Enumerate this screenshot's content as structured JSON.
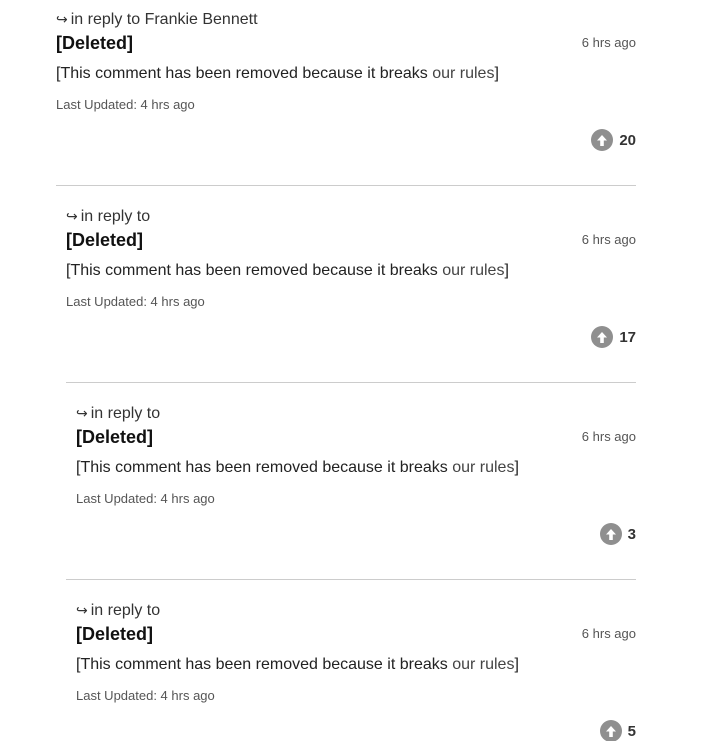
{
  "comments": [
    {
      "reply_prefix": "in reply to",
      "reply_target": "Frankie Bennett",
      "author": "[Deleted]",
      "time": "6 hrs ago",
      "body_text": "[This comment has been removed because it breaks ",
      "body_link": "our rules",
      "body_close": "]",
      "updated": "Last Updated: 4 hrs ago",
      "votes": "20"
    },
    {
      "reply_prefix": "in reply to",
      "reply_target": "",
      "author": "[Deleted]",
      "time": "6 hrs ago",
      "body_text": "[This comment has been removed because it breaks ",
      "body_link": "our rules",
      "body_close": "]",
      "updated": "Last Updated: 4 hrs ago",
      "votes": "17"
    },
    {
      "reply_prefix": "in reply to",
      "reply_target": "",
      "author": "[Deleted]",
      "time": "6 hrs ago",
      "body_text": "[This comment has been removed because it breaks ",
      "body_link": "our rules",
      "body_close": "]",
      "updated": "Last Updated: 4 hrs ago",
      "votes": "3"
    },
    {
      "reply_prefix": "in reply to",
      "reply_target": "",
      "author": "[Deleted]",
      "time": "6 hrs ago",
      "body_text": "[This comment has been removed because it breaks ",
      "body_link": "our rules",
      "body_close": "]",
      "updated": "Last Updated: 4 hrs ago",
      "votes": "5"
    }
  ],
  "icons": {
    "reply": "reply-arrow-icon",
    "upvote": "upvote-arrow-icon"
  }
}
